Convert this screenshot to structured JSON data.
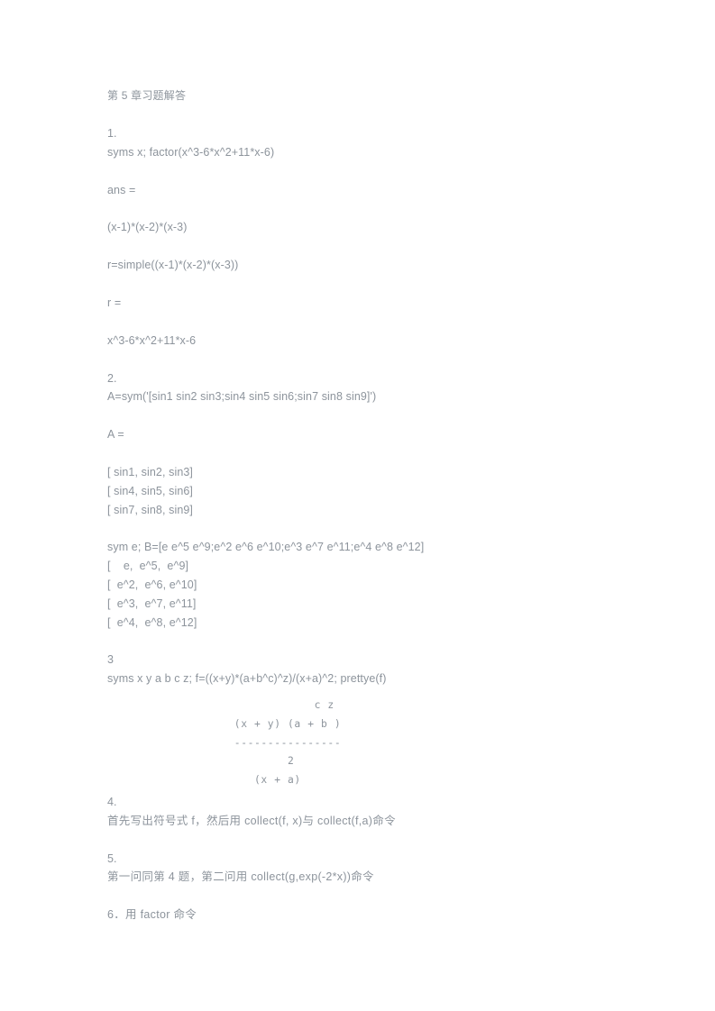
{
  "document": {
    "title": "第 5 章习题解答",
    "sections": [
      {
        "number": "1.",
        "lines": [
          "syms x; factor(x^3-6*x^2+11*x-6)",
          "ans =",
          "(x-1)*(x-2)*(x-3)",
          "r=simple((x-1)*(x-2)*(x-3))",
          "r =",
          "x^3-6*x^2+11*x-6"
        ]
      },
      {
        "number": "2.",
        "command": "A=sym('[sin1 sin2 sin3;sin4 sin5 sin6;sin7 sin8 sin9]')",
        "result_label": "A =",
        "matrix_a": [
          "[ sin1, sin2, sin3]",
          "[ sin4, sin5, sin6]",
          "[ sin7, sin8, sin9]"
        ],
        "command_b": "sym e; B=[e e^5 e^9;e^2 e^6 e^10;e^3 e^7 e^11;e^4 e^8 e^12]",
        "matrix_b": [
          "[    e,  e^5,  e^9]",
          "[  e^2,  e^6, e^10]",
          "[  e^3,  e^7, e^11]",
          "[  e^4,  e^8, e^12]"
        ]
      },
      {
        "number": "3",
        "command": "syms x y a b c z; f=((x+y)*(a+b^c)^z)/(x+a)^2; prettye(f)",
        "pretty": [
          "              c z",
          "  (x + y) (a + b )",
          "  ----------------",
          "          2",
          "     (x + a)"
        ]
      },
      {
        "number": "4.",
        "text": "首先写出符号式 f，然后用 collect(f, x)与 collect(f,a)命令"
      },
      {
        "number": "5.",
        "text": "第一问同第 4 题，第二问用 collect(g,exp(-2*x))命令"
      },
      {
        "number": "6．用 factor 命令",
        "text": ""
      }
    ]
  },
  "colors": {
    "text": "#8d949c",
    "background": "#ffffff"
  }
}
